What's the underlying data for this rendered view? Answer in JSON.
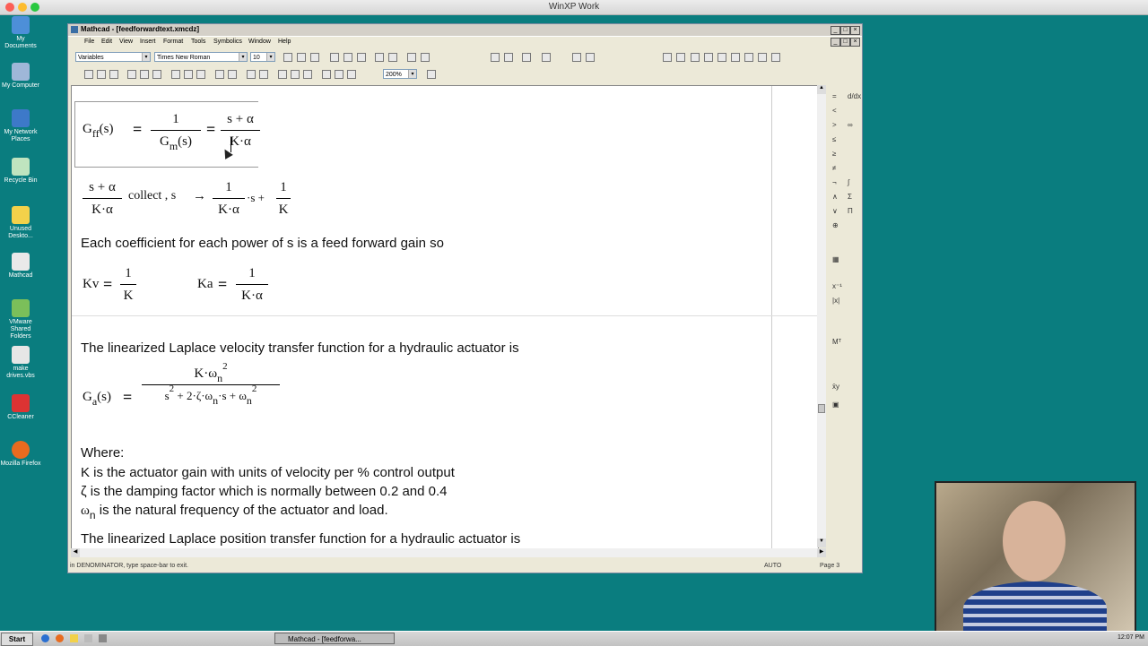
{
  "host": {
    "title": "WinXP Work"
  },
  "desktop_icons": [
    "My Documents",
    "My Computer",
    "My Network Places",
    "Recycle Bin",
    "Unused Deskto...",
    "Mathcad",
    "VMware Shared Folders",
    "make drives.vbs",
    "CCleaner",
    "Mozilla Firefox"
  ],
  "window": {
    "title": "Mathcad - [feedforwardtext.xmcdz]",
    "menu": [
      "File",
      "Edit",
      "View",
      "Insert",
      "Format",
      "Tools",
      "Symbolics",
      "Window",
      "Help"
    ],
    "style_combo": "Variables",
    "font_combo": "Times New Roman",
    "size_combo": "10",
    "zoom_combo": "200%",
    "status_left": "in DENOMINATOR, type space-bar to exit.",
    "status_mode": "AUTO",
    "status_page": "Page 3"
  },
  "doc": {
    "gff_lhs": "G",
    "gff_sub": "ff",
    "gff_arg": "(s)",
    "one": "1",
    "gm_den": "G",
    "gm_sub": "m",
    "gm_arg": "(s)",
    "rhs_num": "s + α",
    "rhs_den": "K·α",
    "collect_kw": "collect , s",
    "arrow": "→",
    "collect_t1_den": "K·α",
    "collect_t1_tail": "·s +",
    "collect_t2_den": "K",
    "coeff_text": "Each coefficient for each power of s is a feed forward gain so",
    "kv_lhs": "Kv",
    "kv_den": "K",
    "ka_lhs": "Ka",
    "ka_den": "K·α",
    "vel_text": "The linearized Laplace velocity transfer function for a hydraulic actuator is",
    "ga_lhs": "G",
    "ga_sub": "a",
    "ga_arg": "(s)",
    "ga_num": "K·ω",
    "ga_num_sub": "n",
    "ga_num_sup": "2",
    "ga_den_a": "s",
    "ga_den_a_sup": "2",
    "ga_den_b": "+ 2·ζ·ω",
    "ga_den_b_sub": "n",
    "ga_den_c": "·s + ω",
    "ga_den_c_sub": "n",
    "ga_den_c_sup": "2",
    "where": "Where:",
    "def_k": "K is the actuator gain with units of velocity per % control output",
    "def_zeta": "ζ is the damping factor which is normally between 0.2 and 0.4",
    "def_omega": "ω",
    "def_omega_sub": "n",
    "def_omega_rest": "is the natural frequency of the actuator and load.",
    "pos_text": "The linearized Laplace position transfer function for a hydraulic actuator is"
  },
  "taskbar": {
    "start": "Start",
    "task": "Mathcad - [feedforwa...",
    "clock": "12:07 PM"
  }
}
